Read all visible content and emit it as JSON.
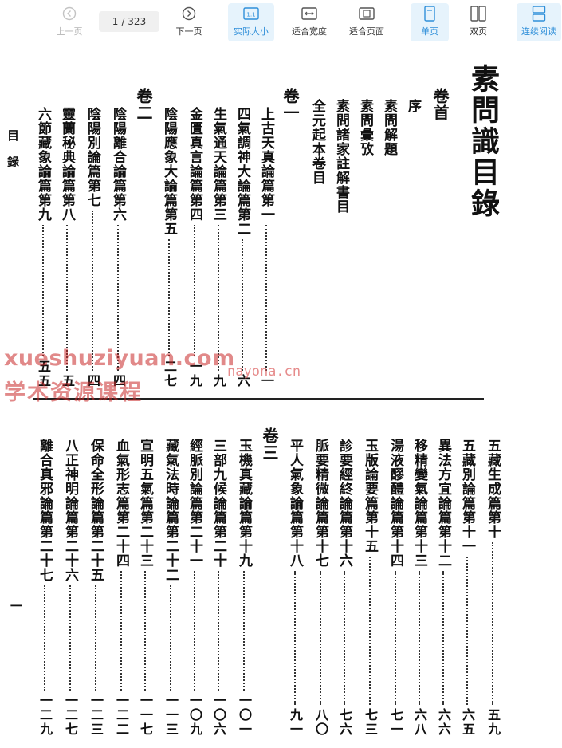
{
  "toolbar": {
    "prev": "上一页",
    "next": "下一页",
    "current_page": "1",
    "total_pages": "/ 323",
    "actual_size": "实际大小",
    "fit_width": "适合宽度",
    "fit_page": "适合页面",
    "single_page": "单页",
    "double_page": "双页",
    "continuous": "连续阅读",
    "colors": {
      "accent": "#2f8fd9",
      "active_bg": "#e6f3fc"
    }
  },
  "document": {
    "title": "素問識目錄",
    "side_label_top": "目錄",
    "side_label_bottom": "一",
    "top_columns": [
      {
        "text": "卷首",
        "num": "",
        "head": true
      },
      {
        "text": "序",
        "num": ""
      },
      {
        "text": "素問解題",
        "num": ""
      },
      {
        "text": "素問彙攷",
        "num": ""
      },
      {
        "text": "素問諸家註解書目",
        "num": ""
      },
      {
        "text": "全元起本卷目",
        "num": ""
      },
      {
        "text": "卷一",
        "num": "",
        "head": true
      },
      {
        "text": "上古天真論篇第一",
        "num": "一"
      },
      {
        "text": "四氣調神大論篇第二",
        "num": "六"
      },
      {
        "text": "生氣通天論篇第三",
        "num": "九"
      },
      {
        "text": "金匱真言論篇第四",
        "num": "一九"
      },
      {
        "text": "陰陽應象大論篇第五",
        "num": "二七"
      },
      {
        "text": "卷二",
        "num": "",
        "head": true
      },
      {
        "text": "陰陽離合論篇第六",
        "num": "四"
      },
      {
        "text": "陰陽別論篇第七",
        "num": "四"
      },
      {
        "text": "靈蘭秘典論篇第八",
        "num": "五"
      },
      {
        "text": "六節藏象論篇第九",
        "num": "五五"
      }
    ],
    "bottom_columns": [
      {
        "text": "五藏生成篇第十",
        "num": "五九"
      },
      {
        "text": "五藏別論篇第十一",
        "num": "六五"
      },
      {
        "text": "異法方宜論篇第十二",
        "num": "六六"
      },
      {
        "text": "移精變氣論篇第十三",
        "num": "六八"
      },
      {
        "text": "湯液醪醴論篇第十四",
        "num": "七一"
      },
      {
        "text": "玉版論要篇第十五",
        "num": "七三"
      },
      {
        "text": "診要經終論篇第十六",
        "num": "七六"
      },
      {
        "text": "脈要精微論篇第十七",
        "num": "八〇"
      },
      {
        "text": "平人氣象論篇第十八",
        "num": "九一"
      },
      {
        "text": "卷三",
        "num": "",
        "head": true
      },
      {
        "text": "玉機真藏論篇第十九",
        "num": "一〇一"
      },
      {
        "text": "三部九候論篇第二十",
        "num": "一〇六"
      },
      {
        "text": "經脈別論篇第二十一",
        "num": "一〇九"
      },
      {
        "text": "藏氣法時論篇第二十二",
        "num": "一一三"
      },
      {
        "text": "宣明五氣篇第二十三",
        "num": "一一七"
      },
      {
        "text": "血氣形志篇第二十四",
        "num": "一二二"
      },
      {
        "text": "保命全形論篇第二十五",
        "num": "一二三"
      },
      {
        "text": "八正神明論篇第二十六",
        "num": "一二七"
      },
      {
        "text": "離合真邪論篇第二十七",
        "num": "一二九"
      }
    ]
  },
  "watermark": {
    "line1": "xueshuziyuan.com",
    "line2": "学术资源课程",
    "line3": "nayona.cn"
  }
}
